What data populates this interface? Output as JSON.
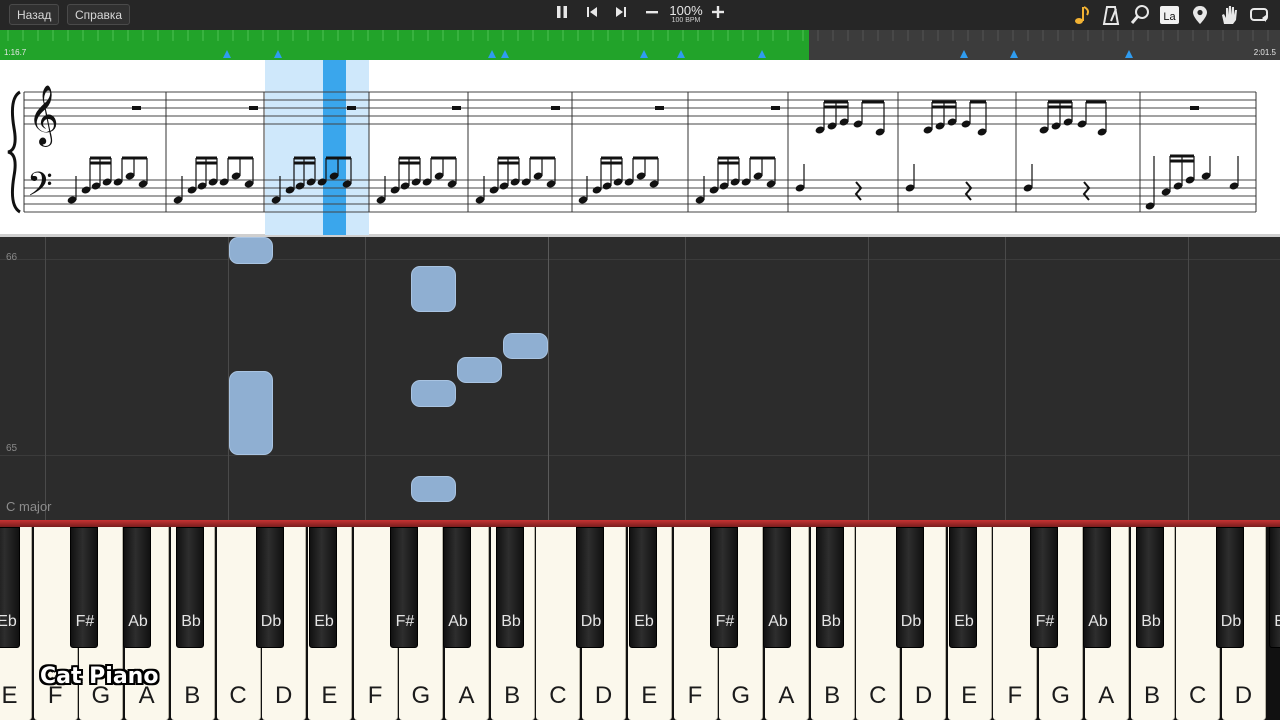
{
  "toolbar": {
    "back_label": "Назад",
    "help_label": "Справка",
    "tempo_percent": "100%",
    "tempo_bpm": "100 BPM",
    "icons": [
      "pause-icon",
      "previous-icon",
      "next-icon",
      "minus-icon",
      "plus-icon",
      "note-icon",
      "metronome-icon",
      "search-icon",
      "note-labels-icon",
      "location-icon",
      "hand-icon",
      "loop-icon"
    ],
    "note_labels_text": "La"
  },
  "timeline": {
    "elapsed": "1:16.7",
    "total": "2:01.5",
    "progress": 0.632
  },
  "piano_roll": {
    "row_number_top": "66",
    "row_number_bottom": "65",
    "key_signature": "C major"
  },
  "keyboard": {
    "white_keys": [
      "E",
      "F",
      "G",
      "A",
      "B",
      "C",
      "D",
      "E",
      "F",
      "G",
      "A",
      "B",
      "C",
      "D",
      "E",
      "F",
      "G",
      "A",
      "B",
      "C",
      "D",
      "E",
      "F",
      "G",
      "A",
      "B",
      "C",
      "D"
    ],
    "black_keys": [
      "Eb",
      "F#",
      "Ab",
      "Bb",
      "Db",
      "Eb",
      "F#",
      "Ab",
      "Bb",
      "Db",
      "Eb",
      "F#",
      "Ab",
      "Bb",
      "Db",
      "Eb",
      "F#",
      "Ab",
      "Bb",
      "Db",
      "Eb"
    ]
  },
  "watermark": "Cat Piano",
  "colors": {
    "progress_green": "#22a32a",
    "highlight": "#44b8f0",
    "note_fill": "#8fafd2",
    "keyboard_red": "#c63232"
  }
}
